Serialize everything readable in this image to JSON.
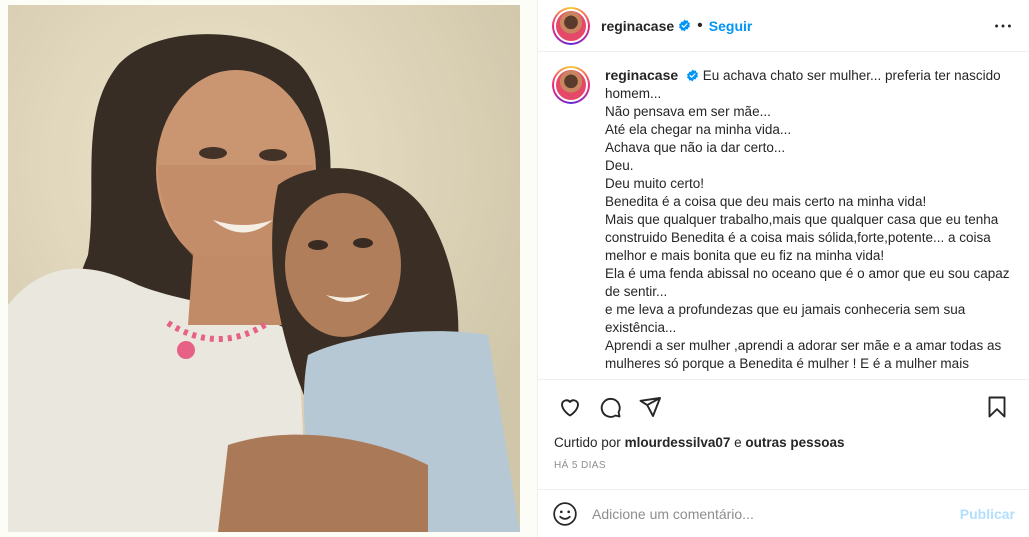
{
  "post": {
    "username": "reginacase",
    "follow_label": "Seguir",
    "verified": true
  },
  "caption": {
    "username": "reginacase",
    "lines": [
      "Eu achava chato ser mulher... preferia ter nascido homem...",
      "Não pensava em ser mãe...",
      "Até ela chegar na minha vida...",
      "Achava que não ia dar certo...",
      "Deu.",
      "Deu muito certo!",
      "Benedita é a coisa que deu mais certo na minha vida!",
      "Mais que qualquer trabalho,mais que qualquer casa que eu tenha construido Benedita é a coisa mais sólida,forte,potente... a coisa melhor e mais bonita que eu fiz na minha vida!",
      "Ela é uma fenda abissal no oceano que é o amor que eu sou capaz de sentir...",
      "e me leva a profundezas que eu jamais conheceria sem sua existência...",
      "Aprendi a ser mulher ,aprendi a adorar ser mãe e a amar todas as mulheres só porque a Benedita é mulher ! E é a mulher mais"
    ]
  },
  "likes": {
    "prefix": "Curtido por",
    "user": "mlourdessilva07",
    "joiner": "e",
    "others": "outras pessoas"
  },
  "time_ago": "HÁ 5 DIAS",
  "comment": {
    "placeholder": "Adicione um comentário...",
    "publish_label": "Publicar"
  },
  "icons": {
    "like": "heart-icon",
    "comment": "comment-icon",
    "share": "share-icon",
    "save": "bookmark-icon",
    "more": "more-options-icon",
    "emoji": "emoji-icon",
    "verified": "verified-badge-icon"
  },
  "colors": {
    "accent": "#0095f6",
    "publish_disabled": "#b2dffc",
    "muted": "#8e8e8e"
  }
}
